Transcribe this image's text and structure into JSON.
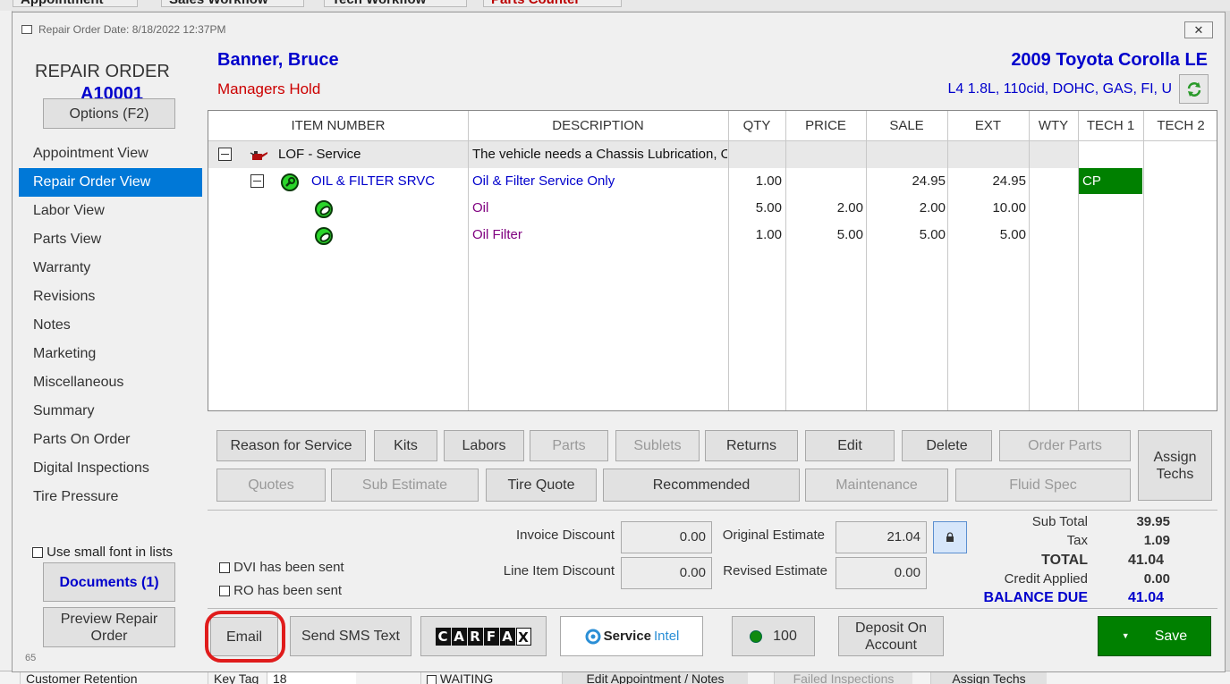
{
  "background": {
    "top_tabs": [
      "Appointment Calendar",
      "Sales Workflow",
      "Tech Workflow",
      "Parts Counter"
    ],
    "bottom_bar": [
      "Customer Retention",
      "Key Tag",
      "18",
      "WAITING",
      "Edit Appointment / Notes",
      "Failed Inspections",
      "Assign Techs"
    ]
  },
  "window": {
    "title": "Repair Order Date:  8/18/2022  12:37PM",
    "close_label": "✕"
  },
  "sidebar": {
    "ro_label": "REPAIR ORDER",
    "ro_number": "A10001",
    "options_label": "Options (F2)",
    "items": [
      {
        "label": "Appointment View",
        "active": false
      },
      {
        "label": "Repair Order View",
        "active": true
      },
      {
        "label": "Labor View",
        "active": false
      },
      {
        "label": "Parts View",
        "active": false
      },
      {
        "label": "Warranty",
        "active": false
      },
      {
        "label": "Revisions",
        "active": false
      },
      {
        "label": "Notes",
        "active": false
      },
      {
        "label": "Marketing",
        "active": false
      },
      {
        "label": "Miscellaneous",
        "active": false
      },
      {
        "label": "Summary",
        "active": false
      },
      {
        "label": "Parts On Order",
        "active": false
      },
      {
        "label": "Digital Inspections",
        "active": false
      },
      {
        "label": "Tire Pressure",
        "active": false
      }
    ],
    "small_font_label": "Use small font in lists",
    "documents_label": "Documents (1)",
    "preview_label": "Preview Repair Order",
    "version": "65"
  },
  "header": {
    "customer_name": "Banner, Bruce",
    "status": "Managers Hold",
    "vehicle": "2009 Toyota  Corolla LE",
    "engine": "L4 1.8L, 110cid, DOHC, GAS, FI, U"
  },
  "grid": {
    "columns": {
      "item_number": "ITEM NUMBER",
      "description": "DESCRIPTION",
      "qty": "QTY",
      "price": "PRICE",
      "sale": "SALE",
      "ext": "EXT",
      "wty": "WTY",
      "tech1": "TECH 1",
      "tech2": "TECH 2"
    },
    "rows": [
      {
        "item": "LOF - Service",
        "description": "The vehicle needs a Chassis Lubrication, Oi",
        "qty": "",
        "price": "",
        "sale": "",
        "ext": "",
        "tech1": ""
      },
      {
        "item": "OIL & FILTER SRVC",
        "description": "Oil & Filter Service Only",
        "qty": "1.00",
        "price": "",
        "sale": "24.95",
        "ext": "24.95",
        "tech1": "CP"
      },
      {
        "item": "",
        "description": "Oil",
        "qty": "5.00",
        "price": "2.00",
        "sale": "2.00",
        "ext": "10.00",
        "tech1": ""
      },
      {
        "item": "",
        "description": "Oil Filter",
        "qty": "1.00",
        "price": "5.00",
        "sale": "5.00",
        "ext": "5.00",
        "tech1": ""
      }
    ],
    "colors": {
      "job": "#000000",
      "labor": "#0000cc",
      "part": "#800080",
      "tech_cp": "#008000"
    }
  },
  "toolbar": {
    "row1": [
      {
        "key": "reason",
        "label": "Reason for Service",
        "disabled": false
      },
      {
        "key": "kits",
        "label": "Kits",
        "disabled": false
      },
      {
        "key": "labors",
        "label": "Labors",
        "disabled": false
      },
      {
        "key": "parts",
        "label": "Parts",
        "disabled": true
      },
      {
        "key": "sublets",
        "label": "Sublets",
        "disabled": true
      },
      {
        "key": "returns",
        "label": "Returns",
        "disabled": false
      },
      {
        "key": "edit",
        "label": "Edit",
        "disabled": false
      },
      {
        "key": "delete",
        "label": "Delete",
        "disabled": false
      },
      {
        "key": "order_parts",
        "label": "Order Parts",
        "disabled": true
      }
    ],
    "row2": [
      {
        "key": "quotes",
        "label": "Quotes",
        "disabled": true
      },
      {
        "key": "sub_estimate",
        "label": "Sub Estimate",
        "disabled": true
      },
      {
        "key": "tire_quote",
        "label": "Tire Quote",
        "disabled": false
      },
      {
        "key": "recommended",
        "label": "Recommended",
        "disabled": false
      },
      {
        "key": "maintenance",
        "label": "Maintenance",
        "disabled": true
      },
      {
        "key": "fluid_spec",
        "label": "Fluid Spec",
        "disabled": true
      }
    ],
    "assign_techs": "Assign Techs"
  },
  "totals": {
    "dvi_sent_label": "DVI has been sent",
    "ro_sent_label": "RO has been sent",
    "invoice_discount_label": "Invoice Discount",
    "invoice_discount": "0.00",
    "line_item_discount_label": "Line Item Discount",
    "line_item_discount": "0.00",
    "original_estimate_label": "Original Estimate",
    "original_estimate": "21.04",
    "revised_estimate_label": "Revised Estimate",
    "revised_estimate": "0.00",
    "sub_total_label": "Sub Total",
    "sub_total": "39.95",
    "tax_label": "Tax",
    "tax": "1.09",
    "total_label": "TOTAL",
    "total": "41.04",
    "credit_label": "Credit Applied",
    "credit": "0.00",
    "balance_label": "BALANCE DUE",
    "balance": "41.04",
    "balance_color": "#0000cc"
  },
  "bottom": {
    "email": "Email",
    "sms": "Send SMS Text",
    "carfax_letters": [
      "C",
      "A",
      "R",
      "F",
      "A",
      "X"
    ],
    "service_intel": "Service",
    "service_intel_2": "Intel",
    "status_count": "100",
    "deposit": "Deposit On Account",
    "save": "Save"
  }
}
